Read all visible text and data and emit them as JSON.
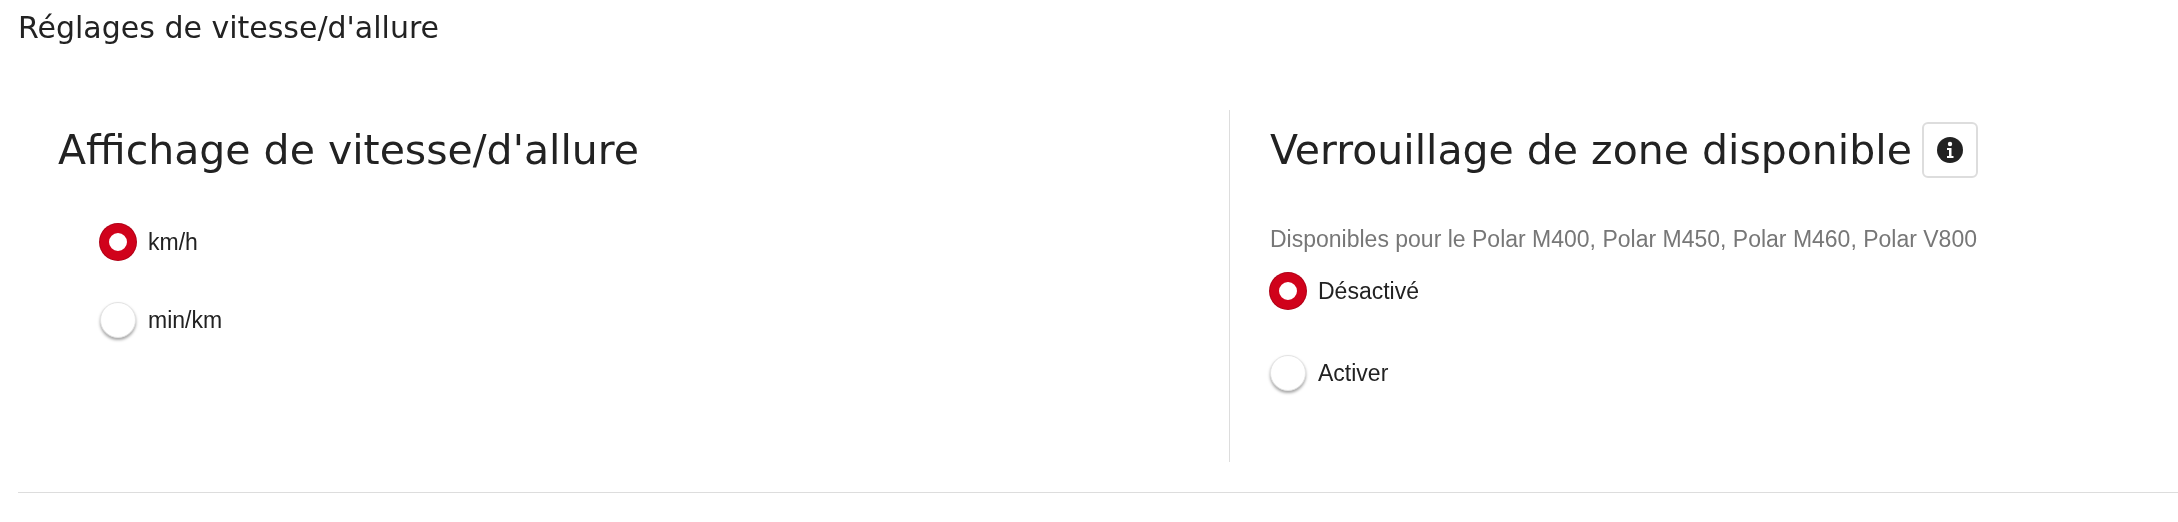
{
  "title": "Réglages de vitesse/d'allure",
  "sections": [
    {
      "heading": "Affichage de vitesse/d'allure",
      "info_button": false,
      "options": [
        {
          "label": "km/h",
          "selected": true
        },
        {
          "label": "min/km",
          "selected": false
        }
      ]
    },
    {
      "heading": "Verrouillage de zone disponible",
      "info_button": true,
      "note": "Disponibles pour le Polar M400, Polar M450, Polar M460, Polar V800",
      "options": [
        {
          "label": "Désactivé",
          "selected": true
        },
        {
          "label": "Activer",
          "selected": false
        }
      ]
    }
  ]
}
